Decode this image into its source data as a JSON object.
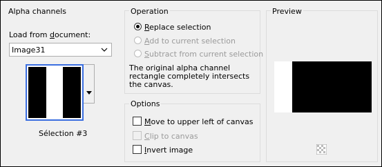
{
  "alpha_panel": {
    "title": "Alpha channels",
    "load_label": "Load from document:",
    "document_value": "Image31",
    "selection_caption": "Sélection #3"
  },
  "operation_panel": {
    "title": "Operation",
    "options": [
      {
        "label": "Replace selection",
        "selected": true,
        "enabled": true
      },
      {
        "label": "Add to current selection",
        "selected": false,
        "enabled": false
      },
      {
        "label": "Subtract from current selection",
        "selected": false,
        "enabled": false
      }
    ],
    "description": "The original alpha channel rectangle completely intersects the canvas."
  },
  "options_panel": {
    "title": "Options",
    "checks": [
      {
        "label": "Move to upper left of canvas",
        "checked": false,
        "enabled": true
      },
      {
        "label": "Clip to canvas",
        "checked": false,
        "enabled": false
      },
      {
        "label": "Invert image",
        "checked": false,
        "enabled": true
      }
    ]
  },
  "preview_panel": {
    "title": "Preview",
    "icon": "checkerboard-icon"
  }
}
